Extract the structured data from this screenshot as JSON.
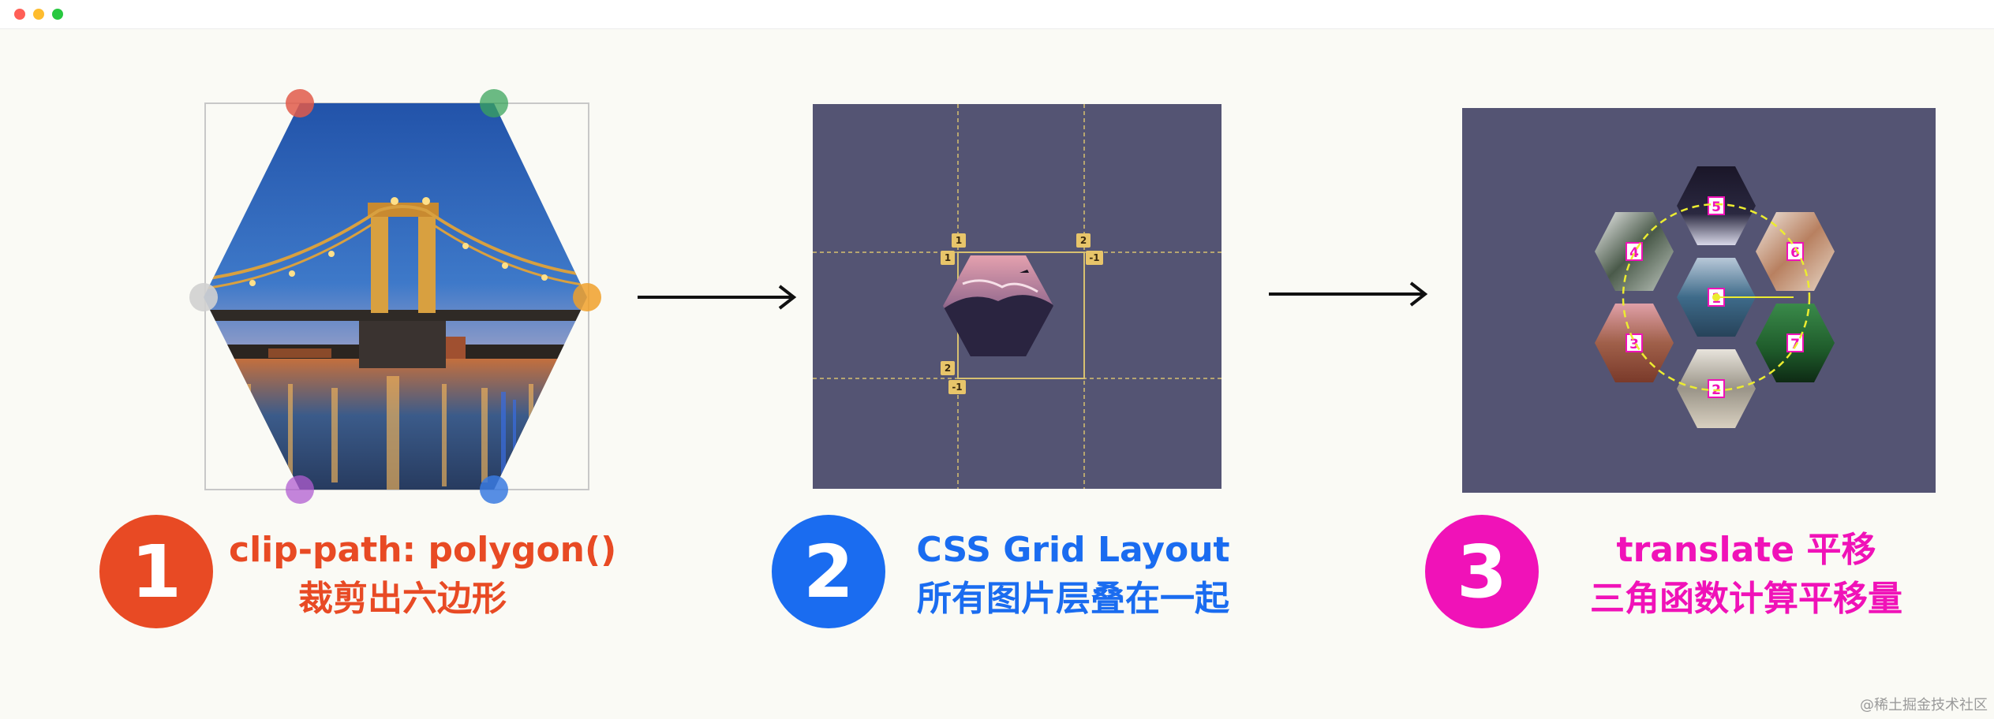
{
  "window": {
    "controls": [
      {
        "name": "close",
        "color": "#ff5f57"
      },
      {
        "name": "minimize",
        "color": "#febc2e"
      },
      {
        "name": "maximize",
        "color": "#28c840"
      }
    ]
  },
  "colors": {
    "step1": "#e84a24",
    "step2": "#1a6cf0",
    "step3": "#f012b8",
    "panel_bg": "#545473",
    "arrow": "#111111"
  },
  "steps": [
    {
      "number": "1",
      "line1": "clip-path: polygon()",
      "line2": "裁剪出六边形"
    },
    {
      "number": "2",
      "line1": "CSS Grid Layout",
      "line2": "所有图片层叠在一起"
    },
    {
      "number": "3",
      "line1": "translate 平移",
      "line2": "三角函数计算平移量"
    }
  ],
  "grid_panel": {
    "line_labels": [
      "1",
      "2",
      "1",
      "-1",
      "2",
      "-1"
    ]
  },
  "translate_panel": {
    "hex_labels": [
      "1",
      "2",
      "3",
      "4",
      "5",
      "6",
      "7"
    ]
  },
  "watermark": "@稀土掘金技术社区"
}
